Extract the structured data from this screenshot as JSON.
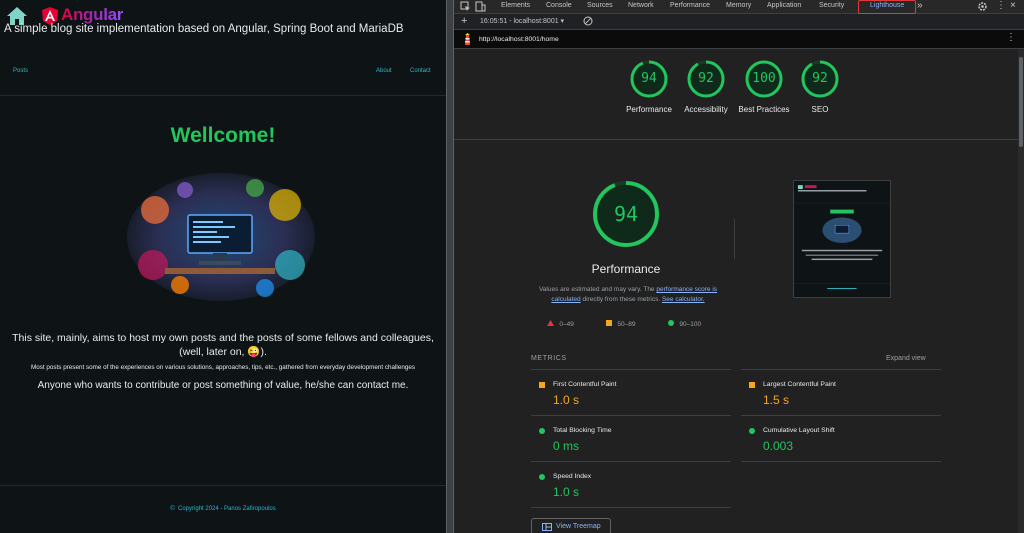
{
  "site": {
    "logo_text": "Angular",
    "tagline": "A simple blog site implementation based on Angular, Spring Boot and MariaDB",
    "nav": {
      "posts": "Posts",
      "about": "About",
      "contact": "Contact"
    },
    "welcome": "Wellcome!",
    "intro": "This site, mainly, aims to host my own posts and the posts of some fellows and colleagues, (well, later on, 😜).",
    "note": "Most posts present some of the experiences on various solutions, approaches, tips, etc., gathered from everyday development challenges",
    "invite": "Anyone who wants to contribute or post something of value, he/she can contact me.",
    "footer": "Copyright 2024 - Panos Zafiropoulos"
  },
  "devtools": {
    "tabs": [
      "Elements",
      "Console",
      "Sources",
      "Network",
      "Performance",
      "Memory",
      "Application",
      "Security",
      "Lighthouse"
    ],
    "active_tab": "Lighthouse",
    "report_time": "16:05:51 - localhost:8001 ▾",
    "url": "http://localhost:8001/home",
    "scores": [
      {
        "label": "Performance",
        "value": "94",
        "fraction": 0.94
      },
      {
        "label": "Accessibility",
        "value": "92",
        "fraction": 0.92
      },
      {
        "label": "Best Practices",
        "value": "100",
        "fraction": 1.0
      },
      {
        "label": "SEO",
        "value": "92",
        "fraction": 0.92
      }
    ],
    "main_score": {
      "value": "94",
      "fraction": 0.94,
      "title": "Performance"
    },
    "desc_pre": "Values are estimated and may vary. The ",
    "desc_link1": "performance score is calculated",
    "desc_mid": " directly from these metrics. ",
    "desc_link2": "See calculator.",
    "legend": [
      "0–49",
      "50–89",
      "90–100"
    ],
    "metrics_title": "METRICS",
    "expand_view": "Expand view",
    "metrics": [
      {
        "name": "First Contentful Paint",
        "value": "1.0 s",
        "status": "average"
      },
      {
        "name": "Largest Contentful Paint",
        "value": "1.5 s",
        "status": "average"
      },
      {
        "name": "Total Blocking Time",
        "value": "0 ms",
        "status": "pass"
      },
      {
        "name": "Cumulative Layout Shift",
        "value": "0.003",
        "status": "pass"
      },
      {
        "name": "Speed Index",
        "value": "1.0 s",
        "status": "pass"
      }
    ],
    "treemap_button": "View Treemap",
    "colors": {
      "pass": "#22c55e",
      "average": "#f5a623",
      "fail": "#e0383b",
      "link": "#8ab4f8",
      "accent_site": "#2fb6c6"
    }
  }
}
